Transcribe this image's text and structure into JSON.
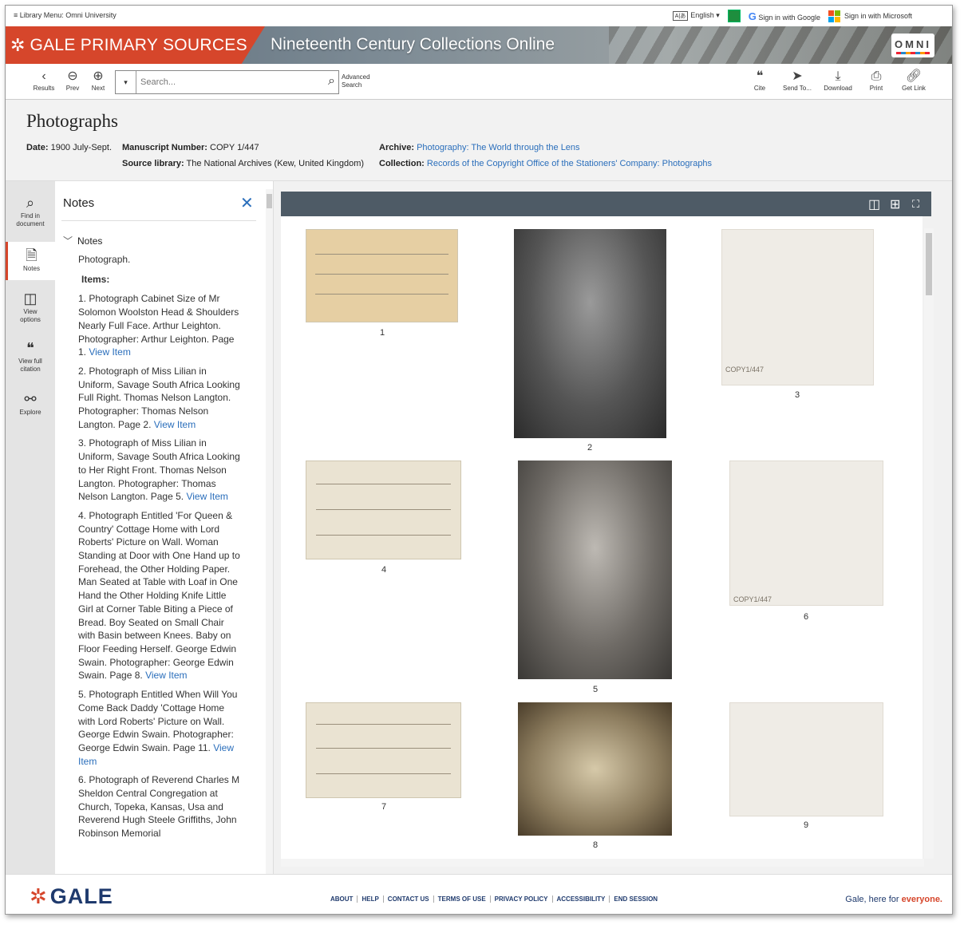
{
  "util": {
    "menu_label": "≡ Library Menu: Omni University",
    "language": "English",
    "google_signin": "Sign in with Google",
    "microsoft_signin": "Sign in with Microsoft"
  },
  "banner": {
    "brand": "GALE PRIMARY SOURCES",
    "collection": "Nineteenth Century Collections Online",
    "logo_text": "OMNI"
  },
  "toolbar": {
    "results": "Results",
    "prev": "Prev",
    "next": "Next",
    "search_placeholder": "Search...",
    "advanced_line1": "Advanced",
    "advanced_line2": "Search",
    "cite": "Cite",
    "send_to": "Send To...",
    "download": "Download",
    "print": "Print",
    "get_link": "Get Link"
  },
  "doc": {
    "title": "Photographs",
    "date_label": "Date:",
    "date": "1900 July-Sept.",
    "manuscript_label": "Manuscript Number:",
    "manuscript": "COPY 1/447",
    "source_label": "Source library:",
    "source": "The National Archives (Kew, United Kingdom)",
    "archive_label": "Archive:",
    "archive": "Photography: The World through the Lens",
    "collection_label": "Collection:",
    "collection": "Records of the Copyright Office of the Stationers' Company: Photographs"
  },
  "rail": {
    "find": [
      "Find in",
      "document"
    ],
    "notes": "Notes",
    "view": [
      "View",
      "options"
    ],
    "citation": [
      "View full",
      "citation"
    ],
    "explore": "Explore"
  },
  "notes": {
    "title": "Notes",
    "section": "Notes",
    "intro": "Photograph.",
    "items_label": "Items:",
    "view_item": "View Item",
    "items": [
      "1. Photograph Cabinet Size of Mr Solomon Woolston Head & Shoulders Nearly Full Face. Arthur Leighton. Photographer: Arthur Leighton. Page 1. ",
      "2. Photograph of Miss Lilian in Uniform, Savage South Africa Looking Full Right. Thomas Nelson Langton. Photographer: Thomas Nelson Langton. Page 2. ",
      "3. Photograph of Miss Lilian in Uniform, Savage South Africa Looking to Her Right Front. Thomas Nelson Langton. Photographer: Thomas Nelson Langton. Page 5. ",
      "4. Photograph Entitled 'For Queen & Country' Cottage Home with Lord Roberts' Picture on Wall. Woman Standing at Door with One Hand up to Forehead, the Other Holding Paper. Man Seated at Table with Loaf in One Hand the Other Holding Knife Little Girl at Corner Table Biting a Piece of Bread. Boy Seated on Small Chair with Basin between Knees. Baby on Floor Feeding Herself. George Edwin Swain. Photographer: George Edwin Swain. Page 8. ",
      "5. Photograph Entitled When Will You Come Back Daddy 'Cottage Home with Lord Roberts' Picture on Wall. George Edwin Swain. Photographer: George Edwin Swain. Page 11. ",
      "6. Photograph of Reverend Charles M Sheldon Central Congregation at Church, Topeka, Kansas, Usa and Reverend Hugh Steele Griffiths, John Robinson Memorial"
    ]
  },
  "viewer": {
    "captions": [
      "1",
      "2",
      "3",
      "4",
      "5",
      "6",
      "7",
      "8",
      "9"
    ],
    "page_stamp": "COPY1/447"
  },
  "footer": {
    "logo": "GALE",
    "links": [
      "ABOUT",
      "HELP",
      "CONTACT US",
      "TERMS OF USE",
      "PRIVACY POLICY",
      "ACCESSIBILITY",
      "END SESSION"
    ],
    "tagline_pre": "Gale, here for ",
    "tagline_em": "everyone."
  },
  "colors": {
    "brand_red": "#d6462b",
    "link_blue": "#2a6ebb",
    "viewer_bar": "#4e5b66",
    "footer_navy": "#1f3a6d"
  }
}
